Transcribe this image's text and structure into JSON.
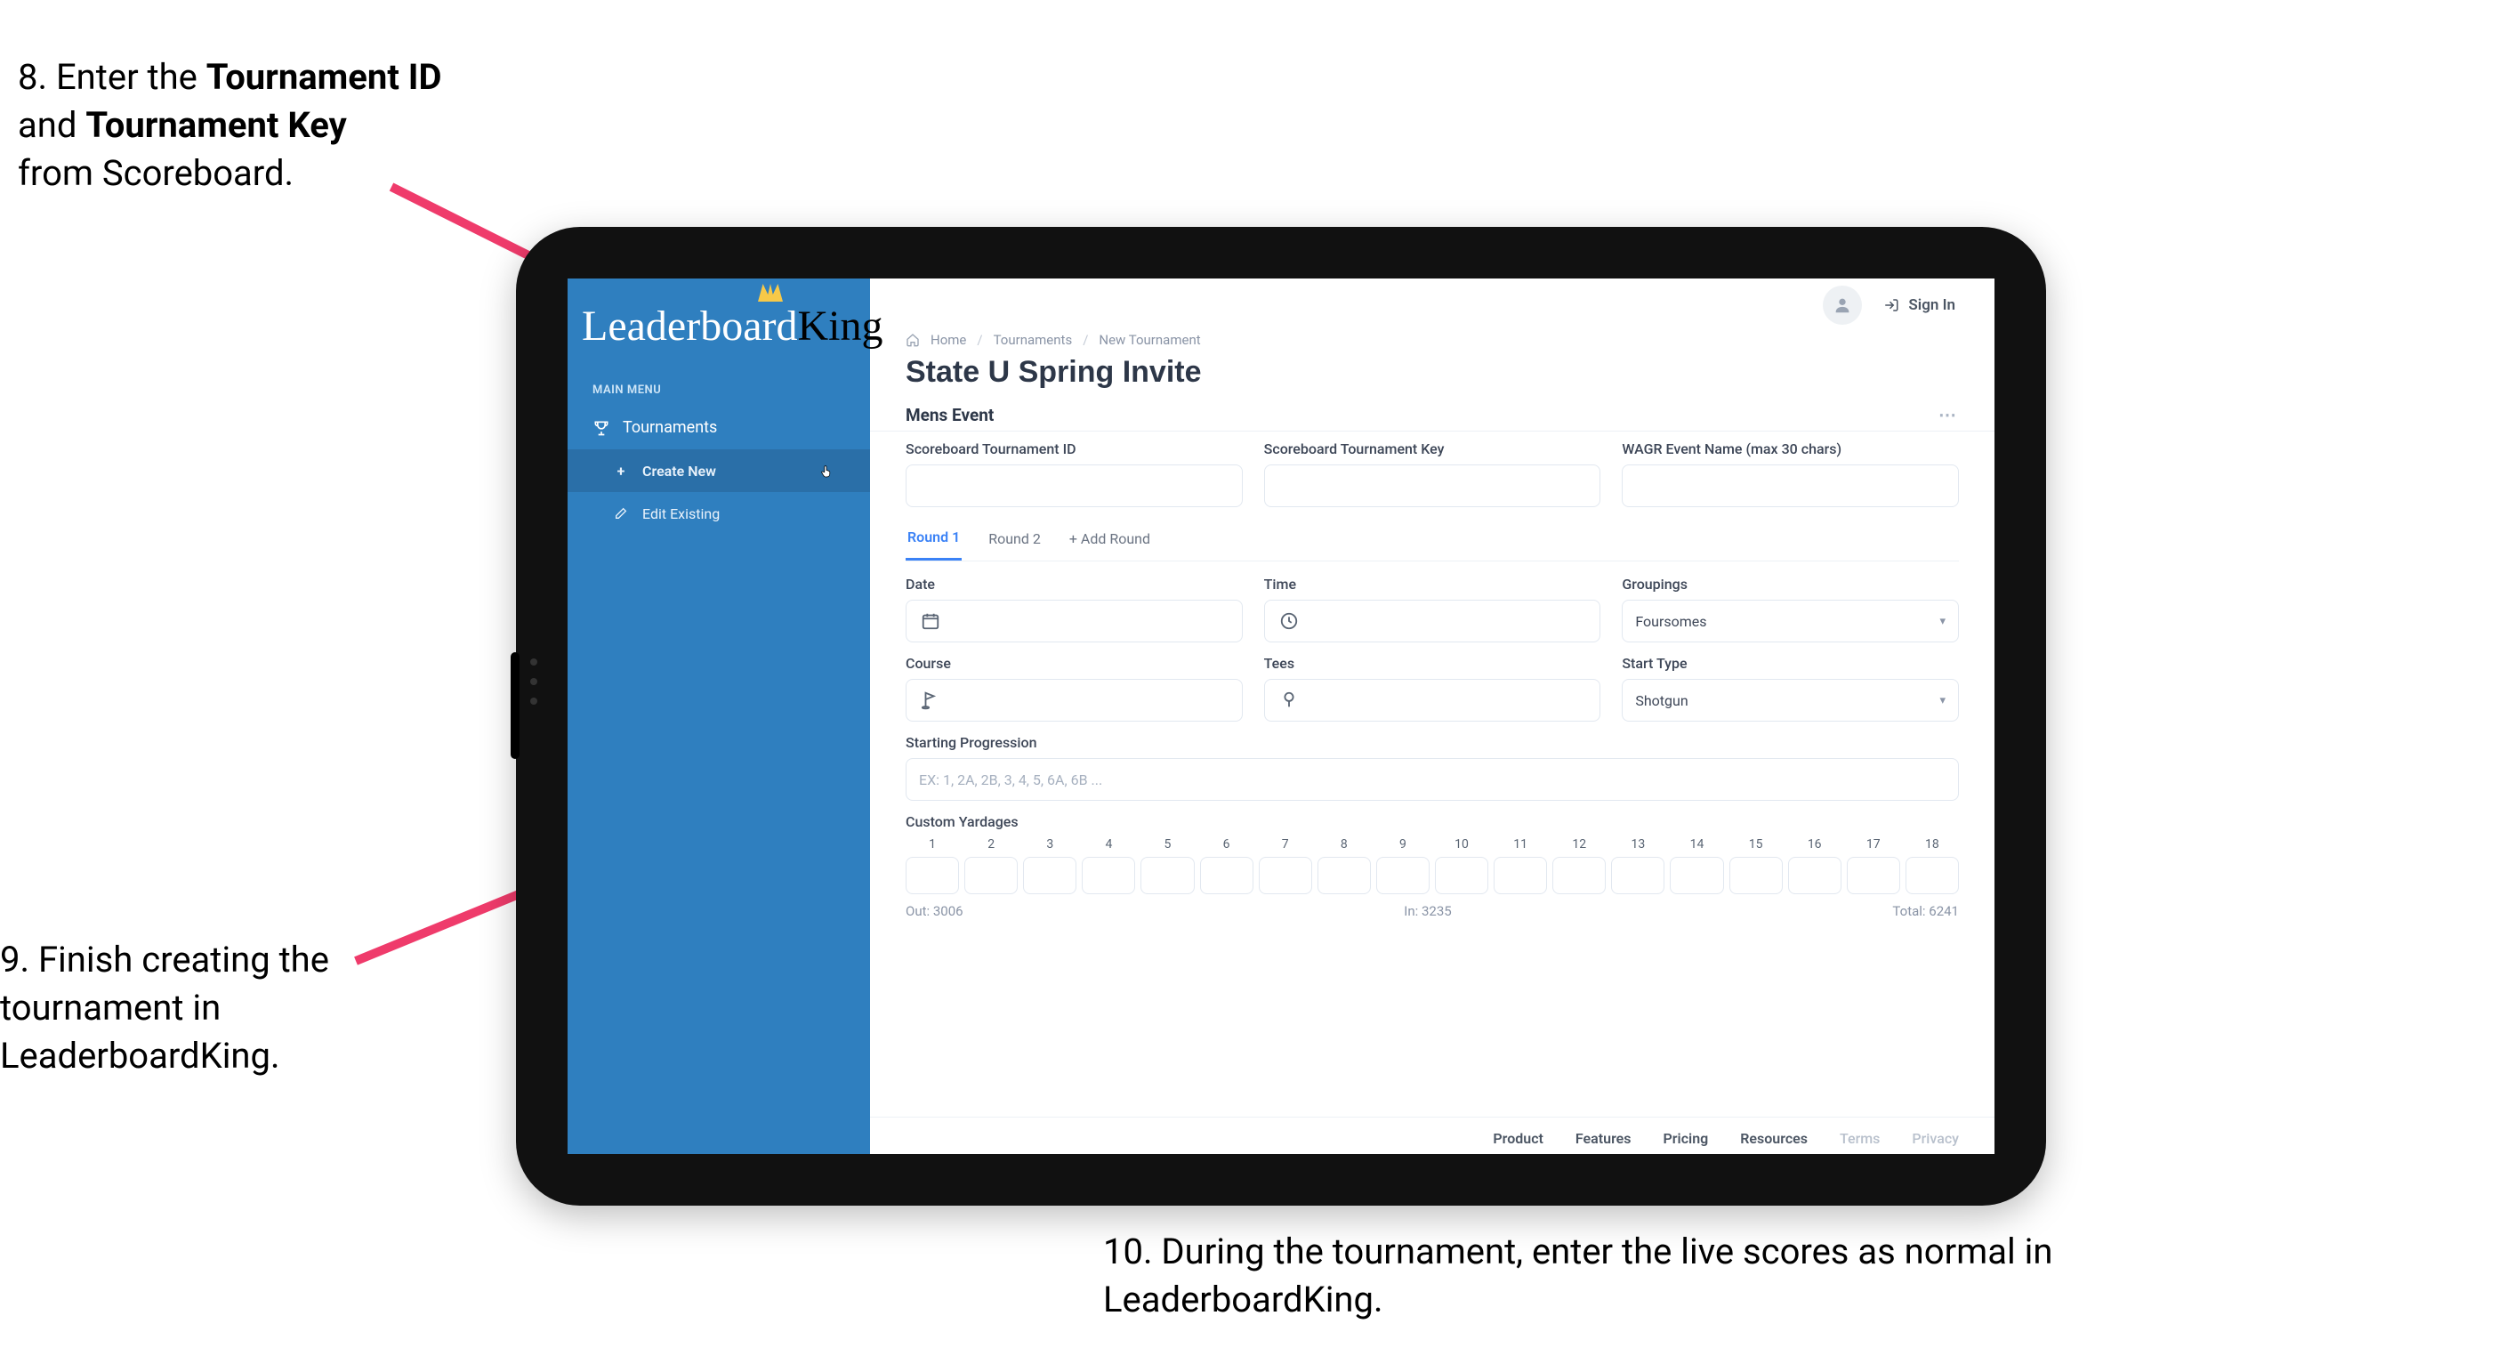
{
  "steps": {
    "s8_prefix": "8. Enter the ",
    "s8_b1": "Tournament ID",
    "s8_mid": " and ",
    "s8_b2": "Tournament Key",
    "s8_suffix": " from Scoreboard.",
    "s9": "9. Finish creating the tournament in LeaderboardKing.",
    "s10": "10. During the tournament, enter the live scores as normal in LeaderboardKing."
  },
  "app": {
    "logo_a": "Leaderboard",
    "logo_b": "King",
    "menu_title": "MAIN MENU",
    "nav_tournaments": "Tournaments",
    "nav_create": "Create New",
    "nav_edit": "Edit Existing",
    "signin": "Sign In",
    "crumb_home": "Home",
    "crumb_t": "Tournaments",
    "crumb_new": "New Tournament",
    "title": "State U Spring Invite",
    "section": "Mens Event",
    "f_sb_id": "Scoreboard Tournament ID",
    "f_sb_key": "Scoreboard Tournament Key",
    "f_wagr": "WAGR Event Name (max 30 chars)",
    "tab_r1": "Round 1",
    "tab_r2": "Round 2",
    "tab_add": "Add Round",
    "f_date": "Date",
    "f_time": "Time",
    "f_group": "Groupings",
    "group_val": "Foursomes",
    "f_course": "Course",
    "f_tees": "Tees",
    "f_start": "Start Type",
    "start_val": "Shotgun",
    "f_prog": "Starting Progression",
    "prog_ph": "EX: 1, 2A, 2B, 3, 4, 5, 6A, 6B ...",
    "f_yard": "Custom Yardages",
    "holes": [
      "1",
      "2",
      "3",
      "4",
      "5",
      "6",
      "7",
      "8",
      "9",
      "10",
      "11",
      "12",
      "13",
      "14",
      "15",
      "16",
      "17",
      "18"
    ],
    "out": "Out: 3006",
    "in": "In: 3235",
    "total": "Total: 6241",
    "footer": {
      "product": "Product",
      "features": "Features",
      "pricing": "Pricing",
      "resources": "Resources",
      "terms": "Terms",
      "privacy": "Privacy"
    }
  }
}
